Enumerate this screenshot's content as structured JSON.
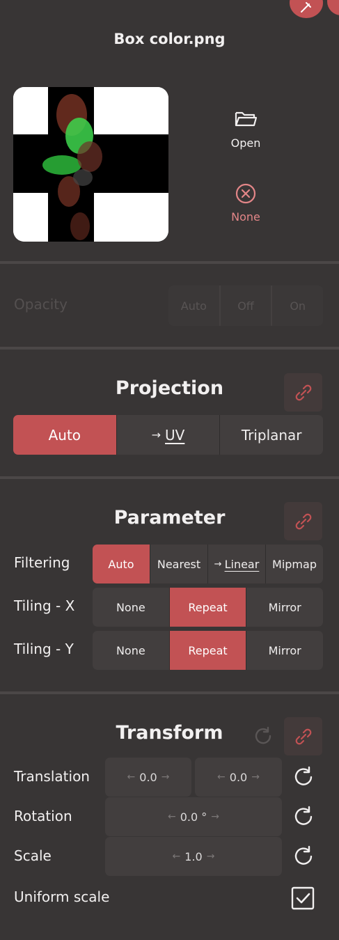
{
  "file": {
    "title": "Box color.png",
    "open_label": "Open",
    "none_label": "None"
  },
  "opacity": {
    "label": "Opacity",
    "options": [
      "Auto",
      "Off",
      "On"
    ]
  },
  "projection": {
    "title": "Projection",
    "options": [
      "Auto",
      "UV",
      "Triplanar"
    ],
    "selected": "Auto",
    "arrow": "→"
  },
  "parameter": {
    "title": "Parameter",
    "filtering": {
      "label": "Filtering",
      "options": [
        "Auto",
        "Nearest",
        "Linear",
        "Mipmap"
      ],
      "selected": "Auto",
      "arrow": "→"
    },
    "tiling_x": {
      "label": "Tiling - X",
      "options": [
        "None",
        "Repeat",
        "Mirror"
      ],
      "selected": "Repeat"
    },
    "tiling_y": {
      "label": "Tiling - Y",
      "options": [
        "None",
        "Repeat",
        "Mirror"
      ],
      "selected": "Repeat"
    }
  },
  "transform": {
    "title": "Transform",
    "translation": {
      "label": "Translation",
      "x": "0.0",
      "y": "0.0"
    },
    "rotation": {
      "label": "Rotation",
      "value": "0.0 °"
    },
    "scale": {
      "label": "Scale",
      "value": "1.0"
    },
    "uniform_scale": {
      "label": "Uniform scale",
      "checked": true
    },
    "arrow_left": "←",
    "arrow_right": "→"
  },
  "colors": {
    "accent": "#c25254",
    "background": "#383535",
    "control": "#423e3e"
  }
}
